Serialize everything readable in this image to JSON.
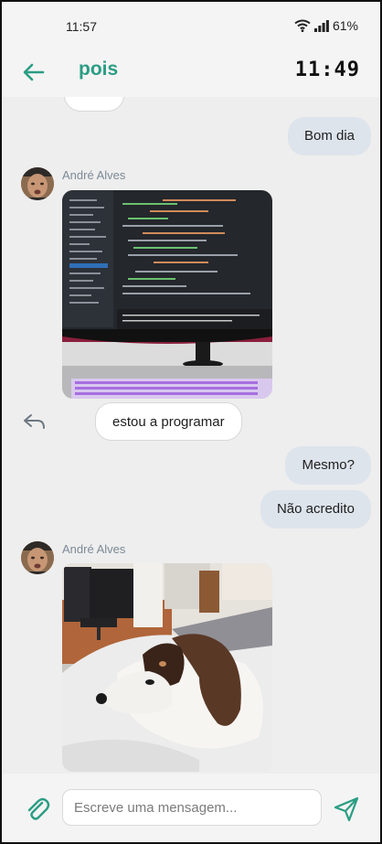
{
  "status_bar": {
    "time": "11:57",
    "battery": "61%",
    "icons": [
      "wifi-icon",
      "signal-icon"
    ]
  },
  "header": {
    "title": "pois",
    "clock": "11:49",
    "back_icon": "arrow-left-icon"
  },
  "messages": {
    "out_1": "Bom dia",
    "sender_1": "André Alves",
    "photo_1": "computer-monitor-code-photo",
    "in_1": "estou a programar",
    "out_2": "Mesmo?",
    "out_3": "Não acredito",
    "sender_2": "André Alves",
    "photo_2": "dog-on-bed-photo"
  },
  "input": {
    "placeholder": "Escreve uma mensagem...",
    "value": ""
  },
  "colors": {
    "accent": "#2a9d84",
    "outgoing_bubble": "#dee4ec",
    "incoming_bubble": "#ffffff",
    "sender_name": "#7d8a96"
  }
}
